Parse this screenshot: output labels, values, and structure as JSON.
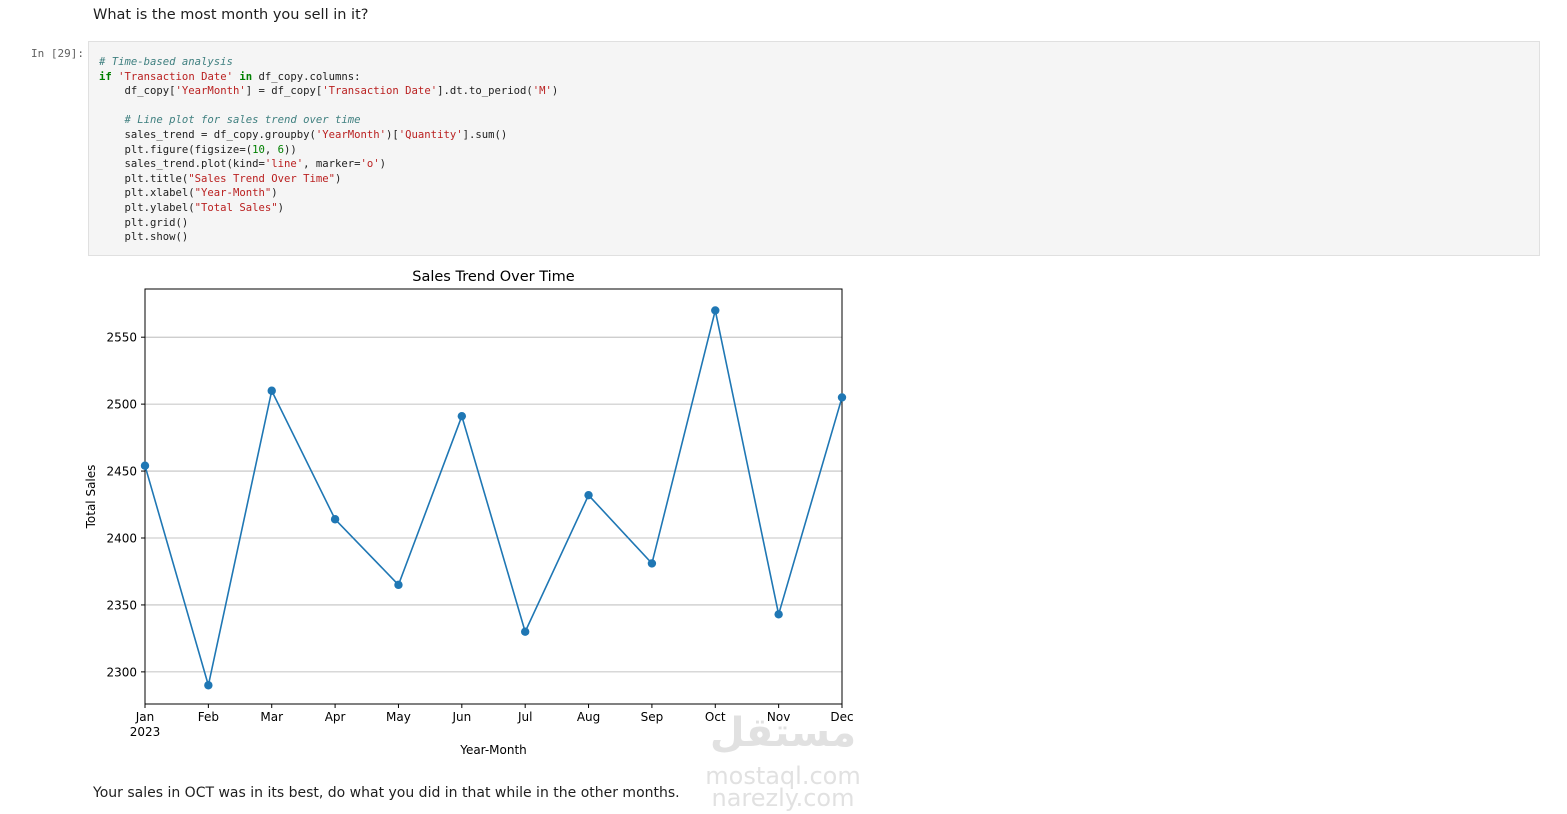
{
  "notebook": {
    "heading": "What is the most month you sell in it?",
    "prompt": "In [29]:",
    "footer": "Your sales in OCT was in its best, do what you did in that while in the other months."
  },
  "code": {
    "lines": [
      [
        {
          "t": "# Time-based analysis",
          "k": "comment"
        }
      ],
      [
        {
          "t": "if",
          "k": "kw"
        },
        {
          "t": " ",
          "k": ""
        },
        {
          "t": "'Transaction Date'",
          "k": "str"
        },
        {
          "t": " ",
          "k": ""
        },
        {
          "t": "in",
          "k": "kw"
        },
        {
          "t": " df_copy.columns:",
          "k": ""
        }
      ],
      [
        {
          "t": "    df_copy[",
          "k": ""
        },
        {
          "t": "'YearMonth'",
          "k": "str"
        },
        {
          "t": "] = df_copy[",
          "k": ""
        },
        {
          "t": "'Transaction Date'",
          "k": "str"
        },
        {
          "t": "].dt.to_period(",
          "k": ""
        },
        {
          "t": "'M'",
          "k": "str"
        },
        {
          "t": ")",
          "k": ""
        }
      ],
      [
        {
          "t": "",
          "k": ""
        }
      ],
      [
        {
          "t": "    ",
          "k": ""
        },
        {
          "t": "# Line plot for sales trend over time",
          "k": "comment"
        }
      ],
      [
        {
          "t": "    sales_trend = df_copy.groupby(",
          "k": ""
        },
        {
          "t": "'YearMonth'",
          "k": "str"
        },
        {
          "t": ")[",
          "k": ""
        },
        {
          "t": "'Quantity'",
          "k": "str"
        },
        {
          "t": "].sum()",
          "k": ""
        }
      ],
      [
        {
          "t": "    plt.figure(figsize=(",
          "k": ""
        },
        {
          "t": "10",
          "k": "num"
        },
        {
          "t": ", ",
          "k": ""
        },
        {
          "t": "6",
          "k": "num"
        },
        {
          "t": "))",
          "k": ""
        }
      ],
      [
        {
          "t": "    sales_trend.plot(kind=",
          "k": ""
        },
        {
          "t": "'line'",
          "k": "str"
        },
        {
          "t": ", marker=",
          "k": ""
        },
        {
          "t": "'o'",
          "k": "str"
        },
        {
          "t": ")",
          "k": ""
        }
      ],
      [
        {
          "t": "    plt.title(",
          "k": ""
        },
        {
          "t": "\"Sales Trend Over Time\"",
          "k": "str"
        },
        {
          "t": ")",
          "k": ""
        }
      ],
      [
        {
          "t": "    plt.xlabel(",
          "k": ""
        },
        {
          "t": "\"Year-Month\"",
          "k": "str"
        },
        {
          "t": ")",
          "k": ""
        }
      ],
      [
        {
          "t": "    plt.ylabel(",
          "k": ""
        },
        {
          "t": "\"Total Sales\"",
          "k": "str"
        },
        {
          "t": ")",
          "k": ""
        }
      ],
      [
        {
          "t": "    plt.grid()",
          "k": ""
        }
      ],
      [
        {
          "t": "    plt.show()",
          "k": ""
        }
      ]
    ]
  },
  "chart_data": {
    "type": "line",
    "title": "Sales Trend Over Time",
    "xlabel": "Year-Month",
    "ylabel": "Total Sales",
    "categories": [
      "Jan",
      "Feb",
      "Mar",
      "Apr",
      "May",
      "Jun",
      "Jul",
      "Aug",
      "Sep",
      "Oct",
      "Nov",
      "Dec"
    ],
    "year_label": "2023",
    "series": [
      {
        "values": [
          2454,
          2290,
          2510,
          2414,
          2365,
          2491,
          2330,
          2432,
          2381,
          2570,
          2343,
          2505
        ]
      }
    ],
    "ylim": [
      2276,
      2586
    ],
    "yticks": [
      2300,
      2350,
      2400,
      2450,
      2500,
      2550
    ],
    "grid": "horizontal",
    "line_color": "#1f77b4"
  },
  "watermark": {
    "arabic": "مستقل",
    "line1": "mostaql.com",
    "line2": "narezly.com"
  }
}
